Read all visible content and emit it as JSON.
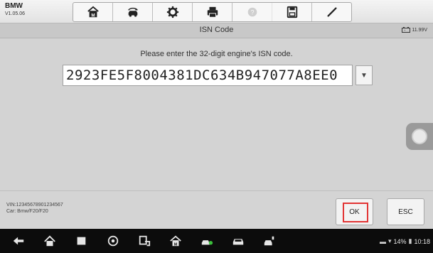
{
  "app": {
    "name": "BMW",
    "version": "V1.05.06"
  },
  "toolbar": {
    "buttons": [
      {
        "name": "home",
        "icon": "home-icon"
      },
      {
        "name": "vehicle-swap",
        "icon": "car-swap-icon"
      },
      {
        "name": "settings",
        "icon": "gear-icon"
      },
      {
        "name": "print",
        "icon": "printer-icon"
      },
      {
        "name": "help",
        "icon": "help-icon",
        "disabled": true
      },
      {
        "name": "save",
        "icon": "save-icon"
      },
      {
        "name": "data-logging",
        "icon": "pen-icon"
      }
    ]
  },
  "screen": {
    "title": "ISN Code",
    "battery_voltage": "11.99V",
    "prompt": "Please enter the 32-digit engine's ISN code.",
    "isn_value": "2923FE5F8004381DC634B947077A8EE0"
  },
  "footer": {
    "vin": "VIN:12345678901234567",
    "car": "Car: Bmw/F20/F20",
    "ok_label": "OK",
    "esc_label": "ESC"
  },
  "statusbar": {
    "time": "10:18",
    "battery": "14%"
  },
  "colors": {
    "highlight": "#e23434",
    "navbar": "#0c0c0c"
  }
}
